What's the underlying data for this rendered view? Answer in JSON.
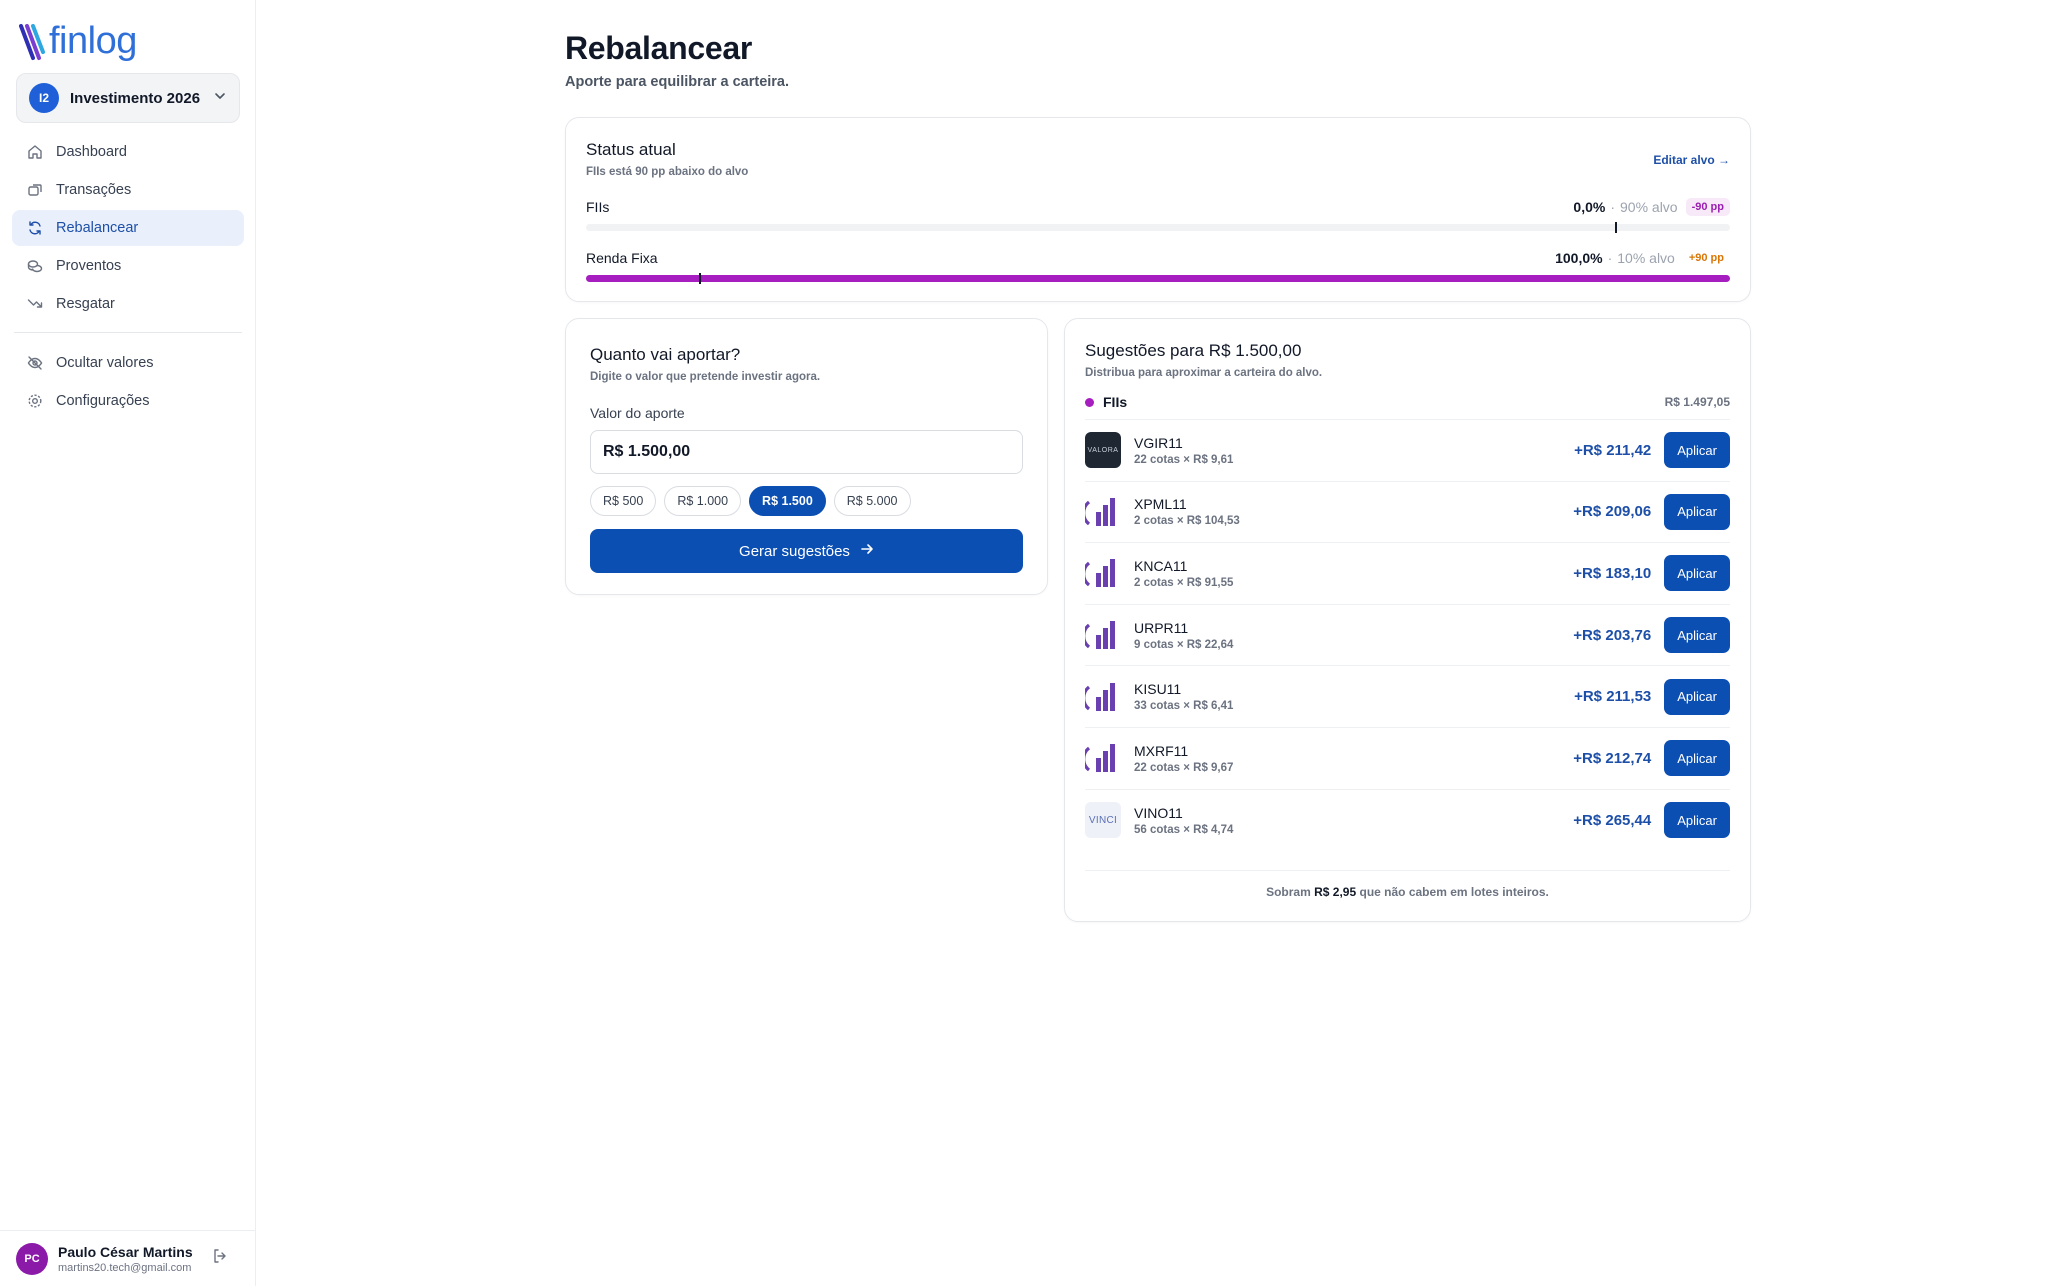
{
  "app": {
    "logo_text": "finlog"
  },
  "workspace": {
    "badge": "I2",
    "name": "Investimento 2026"
  },
  "sidebar": {
    "items": [
      {
        "label": "Dashboard",
        "icon": "home-icon"
      },
      {
        "label": "Transações",
        "icon": "transfer-icon"
      },
      {
        "label": "Rebalancear",
        "icon": "refresh-icon",
        "active": true
      },
      {
        "label": "Proventos",
        "icon": "coins-icon"
      },
      {
        "label": "Resgatar",
        "icon": "trend-down-icon"
      }
    ],
    "secondary": [
      {
        "label": "Ocultar valores",
        "icon": "eye-off-icon"
      },
      {
        "label": "Configurações",
        "icon": "gear-icon"
      }
    ]
  },
  "user": {
    "initials": "PC",
    "name": "Paulo César Martins",
    "email": "martins20.tech@gmail.com"
  },
  "header": {
    "title": "Rebalancear",
    "subtitle": "Aporte para equilibrar a carteira."
  },
  "status": {
    "title": "Status atual",
    "subtitle": "FIIs está 90 pp abaixo do alvo",
    "edit_link": "Editar alvo →",
    "rows": [
      {
        "label": "FIIs",
        "pct": "0,0%",
        "sep": "·",
        "target": "90% alvo",
        "delta": "-90 pp",
        "fill": 0.0,
        "target_frac": 0.9
      },
      {
        "label": "Renda Fixa",
        "pct": "100,0%",
        "sep": "·",
        "target": "10% alvo",
        "delta": "+90 pp",
        "fill": 1.0,
        "target_frac": 0.1
      }
    ]
  },
  "aporte": {
    "title": "Quanto vai aportar?",
    "subtitle": "Digite o valor que pretende investir agora.",
    "field_label": "Valor do aporte",
    "value": "R$ 1.500,00",
    "chips": [
      "R$ 500",
      "R$ 1.000",
      "R$ 1.500",
      "R$ 5.000"
    ],
    "active_chip": 2,
    "button": "Gerar sugestões"
  },
  "suggestions": {
    "title": "Sugestões para R$ 1.500,00",
    "subtitle": "Distribua para aproximar a carteira do alvo.",
    "group": {
      "name": "FIIs",
      "total": "R$ 1.497,05",
      "color": "#a71ec0"
    },
    "assets": [
      {
        "ticker": "VGIR11",
        "qty": "22 cotas × R$ 9,61",
        "amount": "+R$ 211,42",
        "logo": "valora",
        "logo_text": "VALORA"
      },
      {
        "ticker": "XPML11",
        "qty": "2 cotas × R$ 104,53",
        "amount": "+R$ 209,06",
        "logo": "xp",
        "logo_text": ""
      },
      {
        "ticker": "KNCA11",
        "qty": "2 cotas × R$ 91,55",
        "amount": "+R$ 183,10",
        "logo": "xp",
        "logo_text": ""
      },
      {
        "ticker": "URPR11",
        "qty": "9 cotas × R$ 22,64",
        "amount": "+R$ 203,76",
        "logo": "xp",
        "logo_text": ""
      },
      {
        "ticker": "KISU11",
        "qty": "33 cotas × R$ 6,41",
        "amount": "+R$ 211,53",
        "logo": "xp",
        "logo_text": ""
      },
      {
        "ticker": "MXRF11",
        "qty": "22 cotas × R$ 9,67",
        "amount": "+R$ 212,74",
        "logo": "xp",
        "logo_text": ""
      },
      {
        "ticker": "VINO11",
        "qty": "56 cotas × R$ 4,74",
        "amount": "+R$ 265,44",
        "logo": "vinci",
        "logo_text": "VINCI"
      }
    ],
    "apply_label": "Aplicar",
    "footer": {
      "prefix": "Sobram",
      "value": "R$ 2,95",
      "suffix": "que não cabem em lotes inteiros."
    }
  },
  "colors": {
    "primary": "#0b4fb3",
    "accent": "#a71ec0",
    "brand": "#2f6fd8"
  }
}
